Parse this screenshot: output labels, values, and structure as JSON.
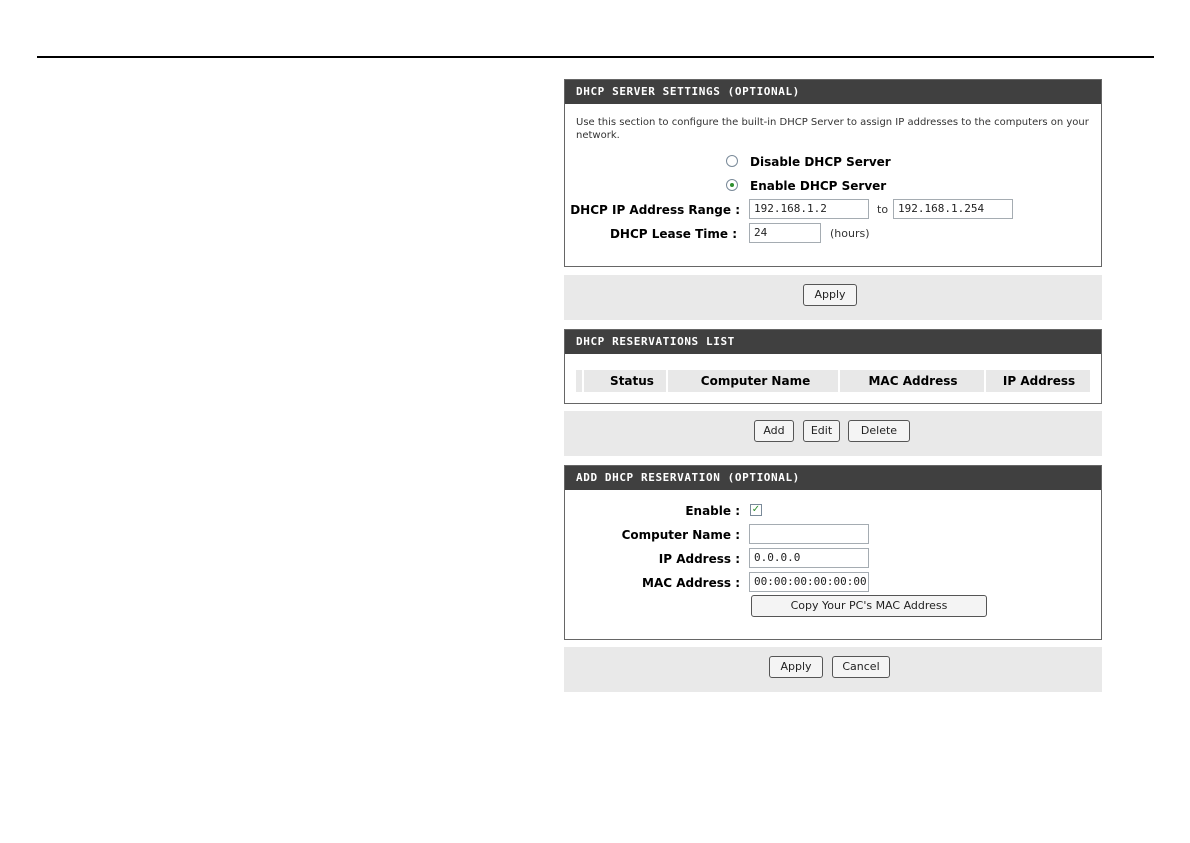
{
  "server": {
    "title": "DHCP SERVER SETTINGS (OPTIONAL)",
    "description": "Use this section to configure the built-in DHCP Server to assign IP addresses to the computers on your network.",
    "disable_label": "Disable DHCP Server",
    "enable_label": "Enable DHCP Server",
    "range_label": "DHCP IP Address Range :",
    "range_start": "192.168.1.2",
    "range_to": "to",
    "range_end": "192.168.1.254",
    "lease_label": "DHCP Lease Time :",
    "lease_value": "24",
    "lease_unit": "(hours)",
    "apply_label": "Apply",
    "selected": "enable"
  },
  "reservations": {
    "title": "DHCP RESERVATIONS LIST",
    "columns": [
      "Status",
      "Computer Name",
      "MAC Address",
      "IP Address"
    ],
    "add_label": "Add",
    "edit_label": "Edit",
    "delete_label": "Delete"
  },
  "add_reservation": {
    "title": "ADD DHCP RESERVATION (OPTIONAL)",
    "enable_label": "Enable :",
    "enable_checked": true,
    "computer_name_label": "Computer Name :",
    "computer_name_value": "",
    "ip_label": "IP Address :",
    "ip_value": "0.0.0.0",
    "mac_label": "MAC Address :",
    "mac_value": "00:00:00:00:00:00",
    "copy_mac_label": "Copy Your PC's MAC Address",
    "apply_label": "Apply",
    "cancel_label": "Cancel"
  },
  "icons": {
    "checkmark": "✓"
  }
}
